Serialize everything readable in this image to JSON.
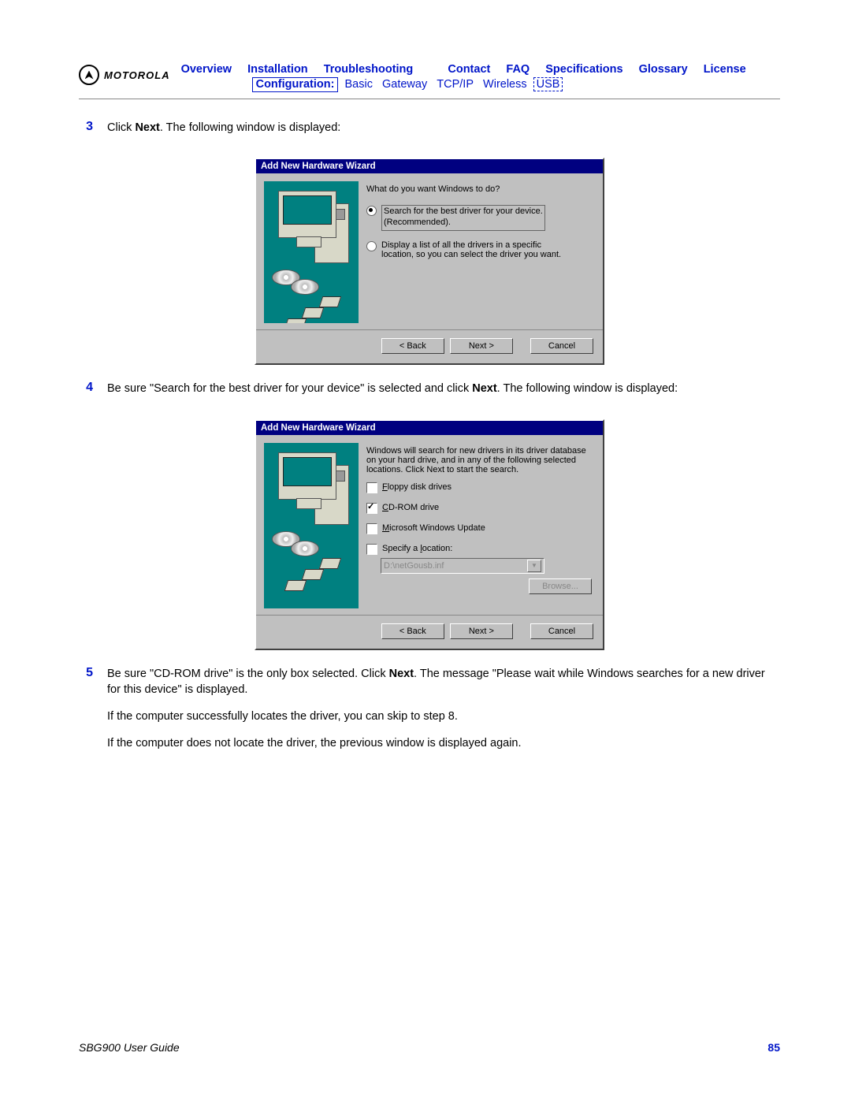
{
  "brand": {
    "name": "MOTOROLA"
  },
  "nav": {
    "row1": [
      "Overview",
      "Installation",
      "Troubleshooting",
      "Contact",
      "FAQ",
      "Specifications",
      "Glossary",
      "License"
    ],
    "config_label": "Configuration:",
    "row2": [
      "Basic",
      "Gateway",
      "TCP/IP",
      "Wireless"
    ],
    "usb": "USB"
  },
  "steps": {
    "s3": {
      "num": "3",
      "text_pre": "Click ",
      "bold": "Next",
      "text_post": ". The following window is displayed:"
    },
    "s4": {
      "num": "4",
      "text_a": "Be sure \"Search for the best driver for your device\" is selected and click ",
      "bold": "Next",
      "text_b": ". The following window is displayed:"
    },
    "s5": {
      "num": "5",
      "text_a": "Be sure \"CD-ROM drive\" is the only box selected. Click ",
      "bold": "Next",
      "text_b": ". The message \"Please wait while Windows searches for a new driver for this device\" is displayed.",
      "p2": "If the computer successfully locates the driver, you can skip to step 8.",
      "p3": "If the computer does not locate the driver, the previous window is displayed again."
    }
  },
  "wizard1": {
    "title": "Add New Hardware Wizard",
    "prompt": "What do you want Windows to do?",
    "opt1_a": "Search for the best driver for your device.",
    "opt1_b": "(Recommended).",
    "opt2_a": "Display a list of all the drivers in a specific",
    "opt2_b": "location, so you can select the driver you want.",
    "btn_back": "< Back",
    "btn_next": "Next >",
    "btn_cancel": "Cancel"
  },
  "wizard2": {
    "title": "Add New Hardware Wizard",
    "intro": "Windows will search for new drivers in its driver database on your hard drive, and in any of the following selected locations. Click Next to start the search.",
    "opt_floppy": "Floppy disk drives",
    "opt_cdrom": "CD-ROM drive",
    "opt_winupd": "Microsoft Windows Update",
    "opt_loc": "Specify a location:",
    "loc_value": "D:\\netGousb.inf",
    "btn_browse": "Browse...",
    "btn_back": "< Back",
    "btn_next": "Next >",
    "btn_cancel": "Cancel"
  },
  "footer": {
    "guide": "SBG900 User Guide",
    "page": "85"
  }
}
